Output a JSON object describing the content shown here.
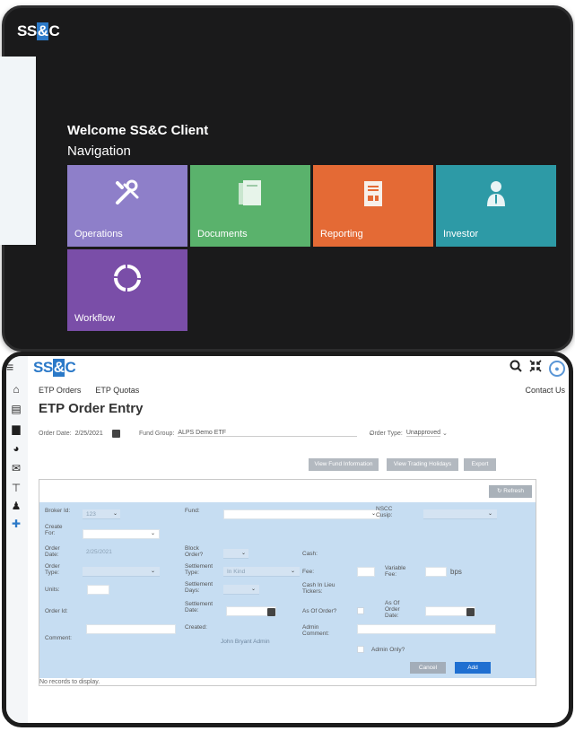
{
  "top": {
    "logo": {
      "pre": "SS",
      "amp": "&",
      "post": "C"
    },
    "welcome": "Welcome SS&C Client",
    "nav_title": "Navigation",
    "tiles": [
      {
        "label": "Operations",
        "icon": "tools-icon",
        "color": "#8e7fc9"
      },
      {
        "label": "Documents",
        "icon": "documents-icon",
        "color": "#5ab26c"
      },
      {
        "label": "Reporting",
        "icon": "report-icon",
        "color": "#e46a35"
      },
      {
        "label": "Investor",
        "icon": "investor-icon",
        "color": "#2d9aa6"
      },
      {
        "label": "Workflow",
        "icon": "workflow-icon",
        "color": "#7a4ea8"
      }
    ]
  },
  "app": {
    "logo": {
      "pre": "SS",
      "amp": "&",
      "post": "C"
    },
    "tabs": [
      "ETP Orders",
      "ETP Quotas"
    ],
    "contact": "Contact Us",
    "title": "ETP Order Entry",
    "order_date_label": "Order Date:",
    "order_date": "2/25/2021",
    "fund_group_label": "Fund Group:",
    "fund_group": "ALPS Demo ETF",
    "order_type_label": "Order Type:",
    "order_type": "Unapproved",
    "buttons": {
      "view_fund": "View Fund Information",
      "view_holidays": "View Trading Holidays",
      "export": "Export",
      "refresh": "Refresh",
      "cancel": "Cancel",
      "add": "Add"
    },
    "form": {
      "broker_id_label": "Broker Id:",
      "broker_id": "123",
      "fund_label": "Fund:",
      "nscc_label": "NSCC Cusip:",
      "create_for_label": "Create For:",
      "order_date_label": "Order Date:",
      "order_date": "2/25/2021",
      "block_order_label": "Block Order?",
      "cash_label": "Cash:",
      "order_type_label": "Order Type:",
      "settlement_type_label": "Settlement Type:",
      "settlement_type": "In Kind",
      "fee_label": "Fee:",
      "variable_fee_label": "Variable Fee:",
      "bps": "bps",
      "units_label": "Units:",
      "settlement_days_label": "Settlement Days:",
      "cash_in_lieu_label": "Cash In Lieu Tickers:",
      "order_id_label": "Order Id:",
      "settlement_date_label": "Settlement Date:",
      "as_of_order_label": "As Of Order?",
      "as_of_order_date_label": "As Of Order Date:",
      "comment_label": "Comment:",
      "created_label": "Created:",
      "created_by": "John Bryant Admin",
      "admin_comment_label": "Admin Comment:",
      "admin_only_label": "Admin Only?"
    },
    "no_records": "No records to display."
  }
}
